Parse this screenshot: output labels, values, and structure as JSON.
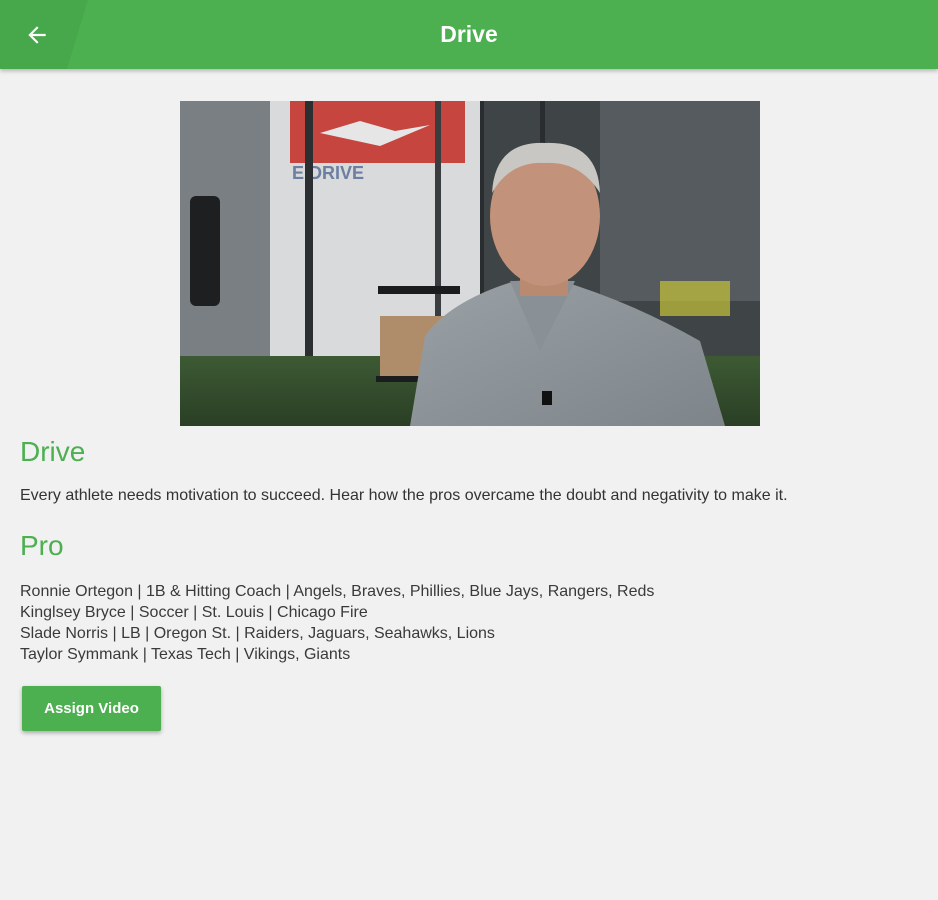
{
  "header": {
    "title": "Drive",
    "back_icon": "arrow-left-icon",
    "color": "#4caf50"
  },
  "video": {
    "thumbnail_description": "man-in-gray-polo-interview-thumbnail",
    "wall_sign_text": "E DRIVE"
  },
  "main": {
    "title": "Drive",
    "description": "Every athlete needs motivation to succeed. Hear how the pros overcame the doubt and negativity to make it.",
    "pro_heading": "Pro",
    "pros": [
      "Ronnie Ortegon | 1B & Hitting Coach | Angels, Braves, Phillies, Blue Jays, Rangers, Reds",
      "Kinglsey Bryce | Soccer | St. Louis | Chicago Fire",
      "Slade Norris | LB | Oregon St. | Raiders, Jaguars, Seahawks, Lions",
      "Taylor Symmank | Texas Tech | Vikings, Giants"
    ],
    "assign_label": "Assign Video"
  },
  "colors": {
    "accent": "#4caf50",
    "background": "#f1f1f1"
  }
}
